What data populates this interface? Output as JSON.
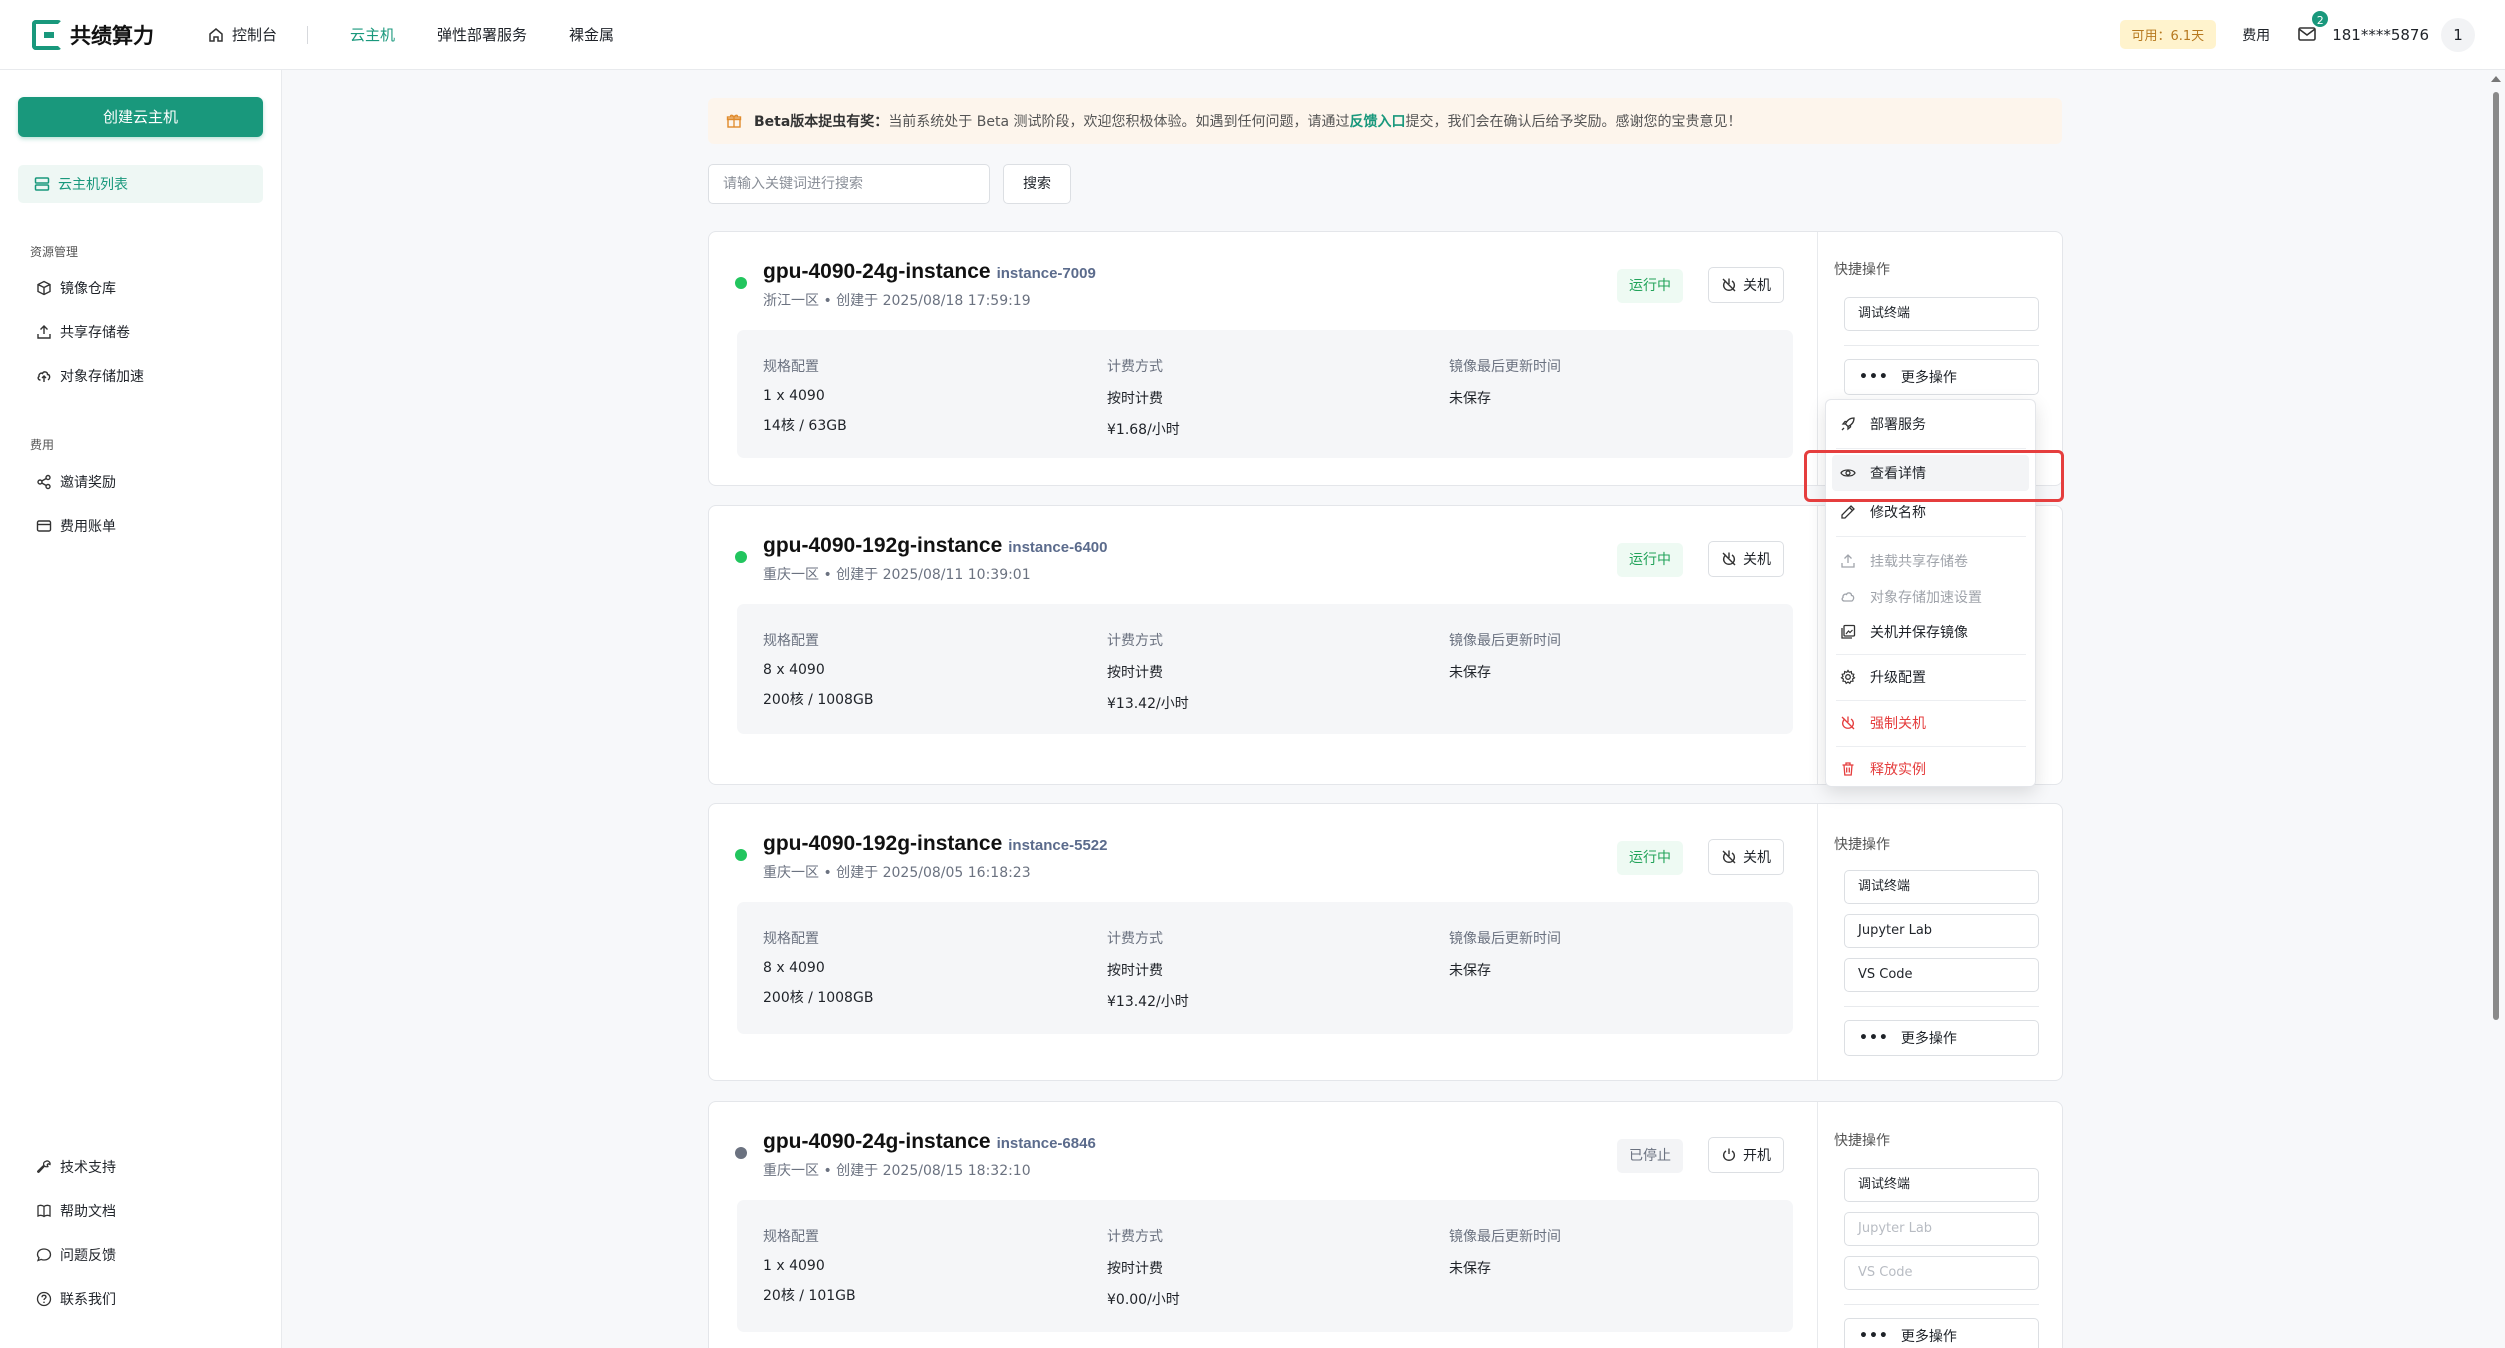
{
  "header": {
    "logo_text": "共绩算力",
    "nav": [
      {
        "label": "控制台"
      },
      {
        "label": "云主机"
      },
      {
        "label": "弹性部署服务"
      },
      {
        "label": "裸金属"
      }
    ],
    "available_badge": "可用：6.1天",
    "fee_link": "费用",
    "mail_count": "2",
    "user_phone": "181****5876",
    "user_avatar": "1"
  },
  "sidebar": {
    "create_button": "创建云主机",
    "active_item": "云主机列表",
    "section_resources": "资源管理",
    "resources": [
      "镜像仓库",
      "共享存储卷",
      "对象存储加速"
    ],
    "section_fees": "费用",
    "fees": [
      "邀请奖励",
      "费用账单"
    ],
    "bottom": [
      "技术支持",
      "帮助文档",
      "问题反馈",
      "联系我们"
    ]
  },
  "banner": {
    "title": "Beta版本捉虫有奖：",
    "text_before": "当前系统处于 Beta 测试阶段，欢迎您积极体验。如遇到任何问题，请通过",
    "link": "反馈入口",
    "text_after": "提交，我们会在确认后给予奖励。感谢您的宝贵意见！"
  },
  "search": {
    "placeholder": "请输入关键词进行搜索",
    "button": "搜索"
  },
  "labels": {
    "spec": "规格配置",
    "billing": "计费方式",
    "image_update": "镜像最后更新时间",
    "quick_ops": "快捷操作",
    "more_ops": "更多操作"
  },
  "instances": [
    {
      "name": "gpu-4090-24g-instance",
      "id": "instance-7009",
      "sub": "浙江一区 • 创建于 2025/08/18 17:59:19",
      "state": "运行中",
      "power": "关机",
      "gpu": "1 x 4090",
      "cpu_mem": "14核 / 63GB",
      "billing": "按时计费",
      "price": "¥1.68/小时",
      "image": "未保存",
      "quick": [
        "调试终端"
      ]
    },
    {
      "name": "gpu-4090-192g-instance",
      "id": "instance-6400",
      "sub": "重庆一区 • 创建于 2025/08/11 10:39:01",
      "state": "运行中",
      "power": "关机",
      "gpu": "8 x 4090",
      "cpu_mem": "200核 / 1008GB",
      "billing": "按时计费",
      "price": "¥13.42/小时",
      "image": "未保存"
    },
    {
      "name": "gpu-4090-192g-instance",
      "id": "instance-5522",
      "sub": "重庆一区 • 创建于 2025/08/05 16:18:23",
      "state": "运行中",
      "power": "关机",
      "gpu": "8 x 4090",
      "cpu_mem": "200核 / 1008GB",
      "billing": "按时计费",
      "price": "¥13.42/小时",
      "image": "未保存",
      "quick": [
        "调试终端",
        "Jupyter Lab",
        "VS Code"
      ]
    },
    {
      "name": "gpu-4090-24g-instance",
      "id": "instance-6846",
      "sub": "重庆一区 • 创建于 2025/08/15 18:32:10",
      "state": "已停止",
      "power": "开机",
      "gpu": "1 x 4090",
      "cpu_mem": "20核 / 101GB",
      "billing": "按时计费",
      "price": "¥0.00/小时",
      "image": "未保存",
      "quick": [
        "调试终端",
        "Jupyter Lab",
        "VS Code"
      ]
    }
  ],
  "menu": [
    {
      "label": "部署服务",
      "icon": "rocket-icon"
    },
    {
      "label": "查看详情",
      "icon": "eye-icon"
    },
    {
      "label": "修改名称",
      "icon": "pencil-icon"
    },
    {
      "label": "挂载共享存储卷",
      "icon": "upload-icon"
    },
    {
      "label": "对象存储加速设置",
      "icon": "cloud-icon"
    },
    {
      "label": "关机并保存镜像",
      "icon": "save-image-icon"
    },
    {
      "label": "升级配置",
      "icon": "gear-icon"
    },
    {
      "label": "强制关机",
      "icon": "power-off-icon"
    },
    {
      "label": "释放实例",
      "icon": "trash-icon"
    }
  ],
  "colors": {
    "brand": "#19987c",
    "running": "#22c55e",
    "danger": "#e53e3e",
    "highlight": "#e53e3e"
  }
}
